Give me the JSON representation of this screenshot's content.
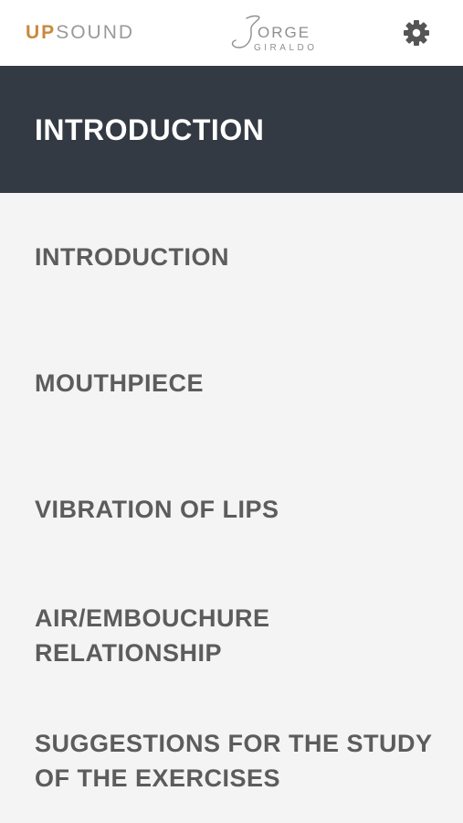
{
  "topbar": {
    "brand_up": "UP",
    "brand_sound": "SOUND",
    "signature_name": "Jorge",
    "signature_surname": "GIRALDO"
  },
  "header": {
    "title": "INTRODUCTION"
  },
  "menu": {
    "items": [
      {
        "label": "INTRODUCTION"
      },
      {
        "label": "MOUTHPIECE"
      },
      {
        "label": "VIBRATION OF LIPS"
      },
      {
        "label": "AIR/EMBOUCHURE RELATIONSHIP"
      },
      {
        "label": "SUGGESTIONS FOR THE STUDY OF THE EXERCISES"
      }
    ]
  },
  "colors": {
    "brand_accent": "#c98a3c",
    "header_bg": "#333a44",
    "menu_text": "#5c5c5c",
    "page_bg": "#f4f4f4"
  },
  "icons": {
    "settings": "gear-icon"
  }
}
